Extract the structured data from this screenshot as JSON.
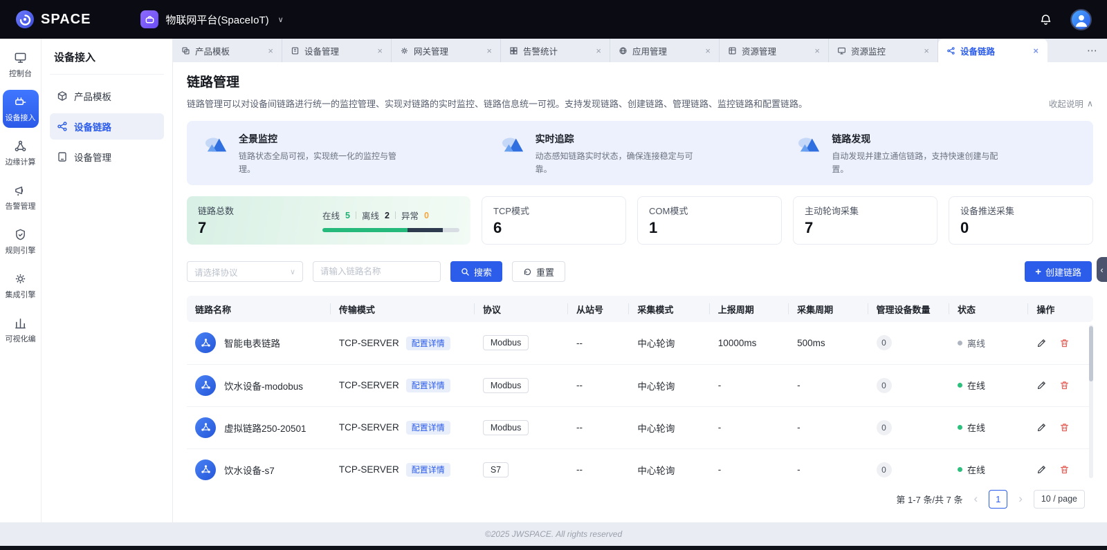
{
  "colors": {
    "accent": "#2b5cea",
    "header_bg": "#0b0c13",
    "online": "#2cc07c",
    "offline": "#aeb5c0",
    "warning": "#f5a63c",
    "banner_bg": "#edf1fd"
  },
  "header": {
    "logo": "SPACE",
    "workspace": "物联网平台(SpaceIoT)"
  },
  "rail": {
    "items": [
      {
        "label": "控制台"
      },
      {
        "label": "设备接入"
      },
      {
        "label": "边缘计算"
      },
      {
        "label": "告警管理"
      },
      {
        "label": "规则引擎"
      },
      {
        "label": "集成引擎"
      },
      {
        "label": "可视化编"
      }
    ]
  },
  "sidebar": {
    "title": "设备接入",
    "items": [
      {
        "label": "产品模板"
      },
      {
        "label": "设备链路"
      },
      {
        "label": "设备管理"
      }
    ]
  },
  "tabs": [
    {
      "label": "产品模板"
    },
    {
      "label": "设备管理"
    },
    {
      "label": "网关管理"
    },
    {
      "label": "告警统计"
    },
    {
      "label": "应用管理"
    },
    {
      "label": "资源管理"
    },
    {
      "label": "资源监控"
    },
    {
      "label": "设备链路"
    }
  ],
  "page": {
    "title": "链路管理",
    "description": "链路管理可以对设备间链路进行统一的监控管理、实现对链路的实时监控、链路信息统一可视。支持发现链路、创建链路、管理链路、监控链路和配置链路。",
    "collapse": "收起说明"
  },
  "features": [
    {
      "title": "全景监控",
      "desc": "链路状态全局可视，实现统一化的监控与管理。"
    },
    {
      "title": "实时追踪",
      "desc": "动态感知链路实时状态，确保连接稳定与可靠。"
    },
    {
      "title": "链路发现",
      "desc": "自动发现并建立通信链路，支持快速创建与配置。"
    }
  ],
  "stats": {
    "total": {
      "label": "链路总数",
      "value": "7",
      "online_label": "在线",
      "online": "5",
      "offline_label": "离线",
      "offline": "2",
      "error_label": "异常",
      "error": "0"
    },
    "cards": [
      {
        "label": "TCP模式",
        "value": "6"
      },
      {
        "label": "COM模式",
        "value": "1"
      },
      {
        "label": "主动轮询采集",
        "value": "7"
      },
      {
        "label": "设备推送采集",
        "value": "0"
      }
    ]
  },
  "filters": {
    "protocol_placeholder": "请选择协议",
    "name_placeholder": "请输入链路名称",
    "search": "搜索",
    "reset": "重置",
    "create": "创建链路"
  },
  "table": {
    "headers": [
      "链路名称",
      "传输模式",
      "协议",
      "从站号",
      "采集模式",
      "上报周期",
      "采集周期",
      "管理设备数量",
      "状态",
      "操作"
    ],
    "config_tag": "配置详情",
    "rows": [
      {
        "name": "智能电表链路",
        "transport": "TCP-SERVER",
        "protocol": "Modbus",
        "slave": "--",
        "collect_mode": "中心轮询",
        "report_period": "10000ms",
        "collect_period": "500ms",
        "devices": "0",
        "status": "离线"
      },
      {
        "name": "饮水设备-modobus",
        "transport": "TCP-SERVER",
        "protocol": "Modbus",
        "slave": "--",
        "collect_mode": "中心轮询",
        "report_period": "-",
        "collect_period": "-",
        "devices": "0",
        "status": "在线"
      },
      {
        "name": "虚拟链路250-20501",
        "transport": "TCP-SERVER",
        "protocol": "Modbus",
        "slave": "--",
        "collect_mode": "中心轮询",
        "report_period": "-",
        "collect_period": "-",
        "devices": "0",
        "status": "在线"
      },
      {
        "name": "饮水设备-s7",
        "transport": "TCP-SERVER",
        "protocol": "S7",
        "slave": "--",
        "collect_mode": "中心轮询",
        "report_period": "-",
        "collect_period": "-",
        "devices": "0",
        "status": "在线"
      }
    ]
  },
  "pagination": {
    "total": "第 1-7 条/共 7 条",
    "page": "1",
    "size": "10 / page"
  },
  "icons": {
    "close": "×",
    "more": "⋯",
    "chevron_down": "∨",
    "chevron_up": "∧",
    "collapse_left": "‹",
    "prev": "‹",
    "next": "›",
    "plus": "+"
  },
  "footer": "©2025 JWSPACE. All rights reserved"
}
